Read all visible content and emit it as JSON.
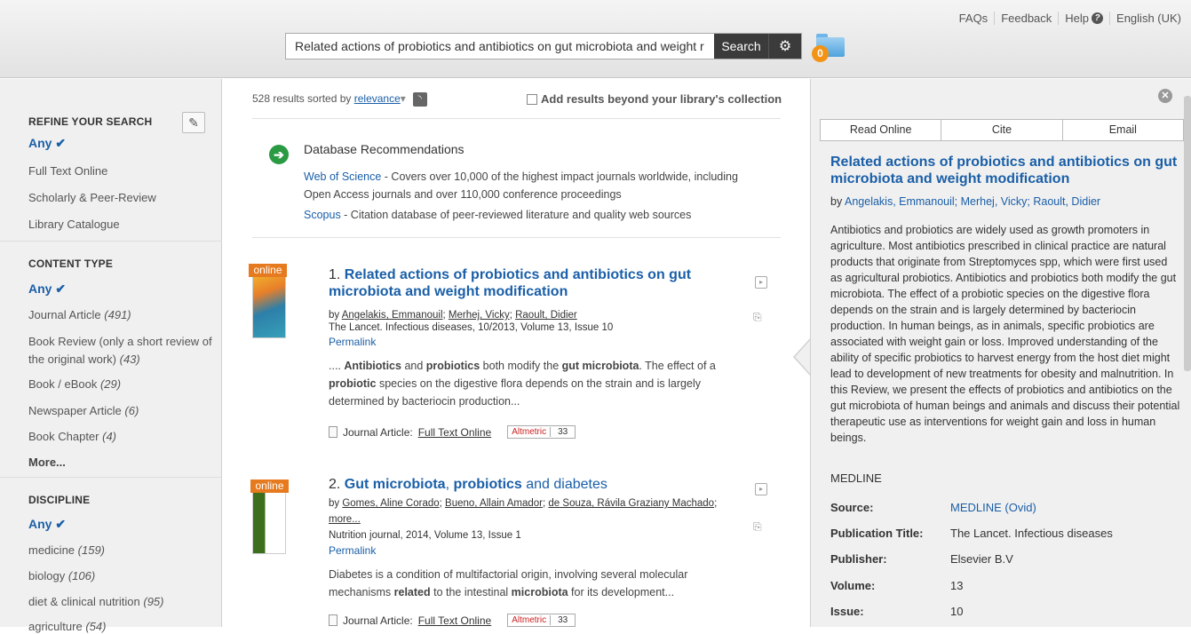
{
  "header": {
    "links": [
      "FAQs",
      "Feedback",
      "Help",
      "English (UK)"
    ],
    "search_value": "Related actions of probiotics and antibiotics on gut microbiota and weight r",
    "search_button": "Search",
    "folder_count": "0"
  },
  "sidebar": {
    "refine_title": "REFINE YOUR SEARCH",
    "refine_any": "Any ✔",
    "refine_items": [
      "Full Text Online",
      "Scholarly & Peer-Review",
      "Library Catalogue"
    ],
    "content_title": "CONTENT TYPE",
    "content_any": "Any ✔",
    "content_items": [
      {
        "label": "Journal Article",
        "count": "(491)"
      },
      {
        "label": "Book Review (only a short review of the original work)",
        "count": "(43)"
      },
      {
        "label": "Book / eBook",
        "count": "(29)"
      },
      {
        "label": "Newspaper Article",
        "count": "(6)"
      },
      {
        "label": "Book Chapter",
        "count": "(4)"
      }
    ],
    "more": "More...",
    "discipline_title": "DISCIPLINE",
    "discipline_any": "Any ✔",
    "discipline_items": [
      {
        "label": "medicine",
        "count": "(159)"
      },
      {
        "label": "biology",
        "count": "(106)"
      },
      {
        "label": "diet & clinical nutrition",
        "count": "(95)"
      },
      {
        "label": "agriculture",
        "count": "(54)"
      }
    ]
  },
  "results": {
    "count_text": "528 results sorted by",
    "sort": "relevance",
    "beyond_label": "Add results beyond your library's collection",
    "rec_title": "Database Recommendations",
    "rec1_link": "Web of Science",
    "rec1_text": " - Covers over 10,000 of the highest impact journals worldwide, including",
    "rec1_text2": "Open Access journals and over 110,000 conference proceedings",
    "rec2_link": "Scopus",
    "rec2_text": " - Citation database of peer-reviewed literature and quality web sources",
    "online_tag": "online",
    "items": [
      {
        "num": "1.",
        "title": "Related actions of probiotics and antibiotics on gut microbiota and weight modification",
        "authors": [
          "Angelakis, Emmanouil",
          "Merhej, Vicky",
          "Raoult, Didier"
        ],
        "source": "The Lancet. Infectious diseases, 10/2013, Volume 13, Issue 10",
        "permalink": "Permalink",
        "snippet_html": ".... <b>Antibiotics</b> and <b>probiotics</b> both modify the <b>gut microbiota</b>. The effect of a <b>probiotic</b> species on the digestive flora depends on the strain and is largely determined by bacteriocin production...",
        "type_label": "Journal Article:",
        "fulltext": "Full Text Online",
        "altmetric": "Altmetric",
        "alt_score": "33"
      },
      {
        "num": "2.",
        "title_b1": "Gut microbiota",
        "title_sep": ", ",
        "title_b2": "probiotics",
        "title_rest": " and diabetes",
        "authors": [
          "Gomes, Aline Corado",
          "Bueno, Allain Amador",
          "de Souza, Rávila Graziany Machado"
        ],
        "more": "more...",
        "source": "Nutrition journal, 2014, Volume 13, Issue 1",
        "permalink": "Permalink",
        "snippet_html": "Diabetes is a condition of multifactorial origin, involving several molecular mechanisms <b>related</b> to the intestinal <b>microbiota</b> for its development...",
        "type_label": "Journal Article:",
        "fulltext": "Full Text Online",
        "altmetric": "Altmetric",
        "alt_score": "33"
      }
    ]
  },
  "detail": {
    "tabs": [
      "Read Online",
      "Cite",
      "Email"
    ],
    "title": "Related actions of probiotics and antibiotics on gut microbiota and weight modification",
    "by": "by",
    "authors": "Angelakis, Emmanouil; Merhej, Vicky; Raoult, Didier",
    "abstract": "Antibiotics and probiotics are widely used as growth promoters in agriculture. Most antibiotics prescribed in clinical practice are natural products that originate from Streptomyces spp, which were first used as agricultural probiotics. Antibiotics and probiotics both modify the gut microbiota. The effect of a probiotic species on the digestive flora depends on the strain and is largely determined by bacteriocin production. In human beings, as in animals, specific probiotics are associated with weight gain or loss. Improved understanding of the ability of specific probiotics to harvest energy from the host diet might lead to development of new treatments for obesity and malnutrition. In this Review, we present the effects of probiotics and antibiotics on the gut microbiota of human beings and animals and discuss their potential therapeutic use as interventions for weight gain and loss in human beings.",
    "source_db": "MEDLINE",
    "fields": [
      {
        "k": "Source:",
        "v": "MEDLINE (Ovid)"
      },
      {
        "k": "Publication Title:",
        "v": "The Lancet. Infectious diseases"
      },
      {
        "k": "Publisher:",
        "v": "Elsevier B.V"
      },
      {
        "k": "Volume:",
        "v": "13"
      },
      {
        "k": "Issue:",
        "v": "10"
      }
    ]
  }
}
